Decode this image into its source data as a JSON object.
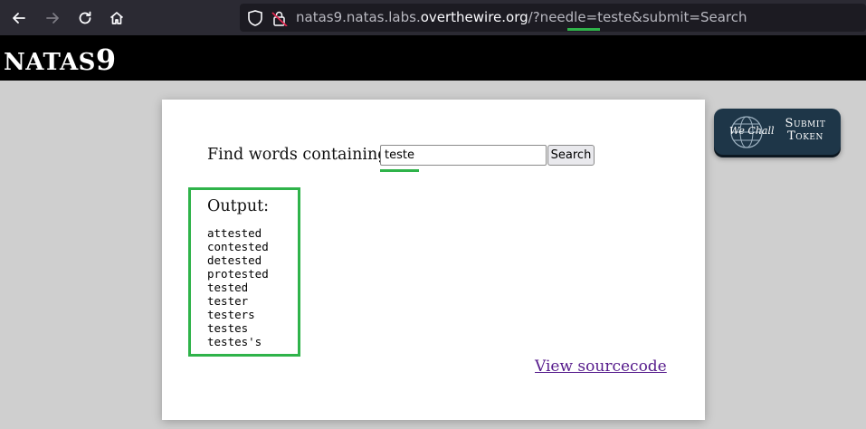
{
  "browser": {
    "url_prefix": "natas9.natas.labs.",
    "url_domain": "overthewire.org",
    "url_path": "/?needle=teste&submit=Search"
  },
  "header": {
    "title_text": "NATAS",
    "title_number": "9"
  },
  "form": {
    "label": "Find words containing:",
    "input_value": "teste",
    "submit_label": "Search"
  },
  "output": {
    "title": "Output:",
    "lines": [
      "attested",
      "contested",
      "detested",
      "protested",
      "tested",
      "tester",
      "testers",
      "testes",
      "testes's"
    ]
  },
  "footer": {
    "source_link": "View sourcecode"
  },
  "wechall": {
    "logo_text": "We Chall",
    "label_line1": "Submit",
    "label_line2": "Token"
  },
  "colors": {
    "highlight_green": "#2fb34a",
    "header_bg": "#000000",
    "page_bg": "#cfcfcf",
    "link": "#551a8b"
  }
}
